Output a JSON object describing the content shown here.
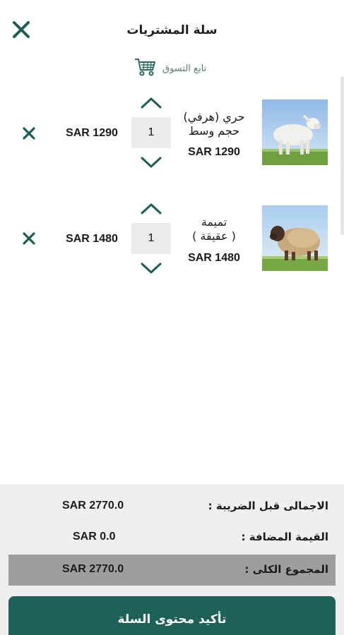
{
  "header": {
    "title": "سلة المشتريات",
    "close_icon": "close-icon",
    "continue_label": "تابع التسوق",
    "cart_icon": "shopping-cart-icon"
  },
  "items": [
    {
      "name_line1": "حري (هرفي)",
      "name_line2": "حجم وسط",
      "price": "SAR 1290",
      "quantity": "1",
      "line_total": "SAR 1290",
      "image": "white-sheep-photo"
    },
    {
      "name_line1": "تميمة",
      "name_line2": "( عقيقة )",
      "price": "SAR 1480",
      "quantity": "1",
      "line_total": "SAR 1480",
      "image": "brown-sheep-photo"
    }
  ],
  "summary": {
    "subtotal_label": "الاجمالى قبل الضريبة :",
    "subtotal_value": "SAR 2770.0",
    "vat_label": "القيمة المضافة :",
    "vat_value": "SAR 0.0",
    "total_label": "المجموع الكلى :",
    "total_value": "SAR 2770.0"
  },
  "confirm_label": "تأكيد محتوى السلة",
  "colors": {
    "accent": "#1e6157",
    "icon_green": "#1f5d54",
    "summary_bg": "#efefef",
    "total_bg": "#9e9e9e"
  }
}
